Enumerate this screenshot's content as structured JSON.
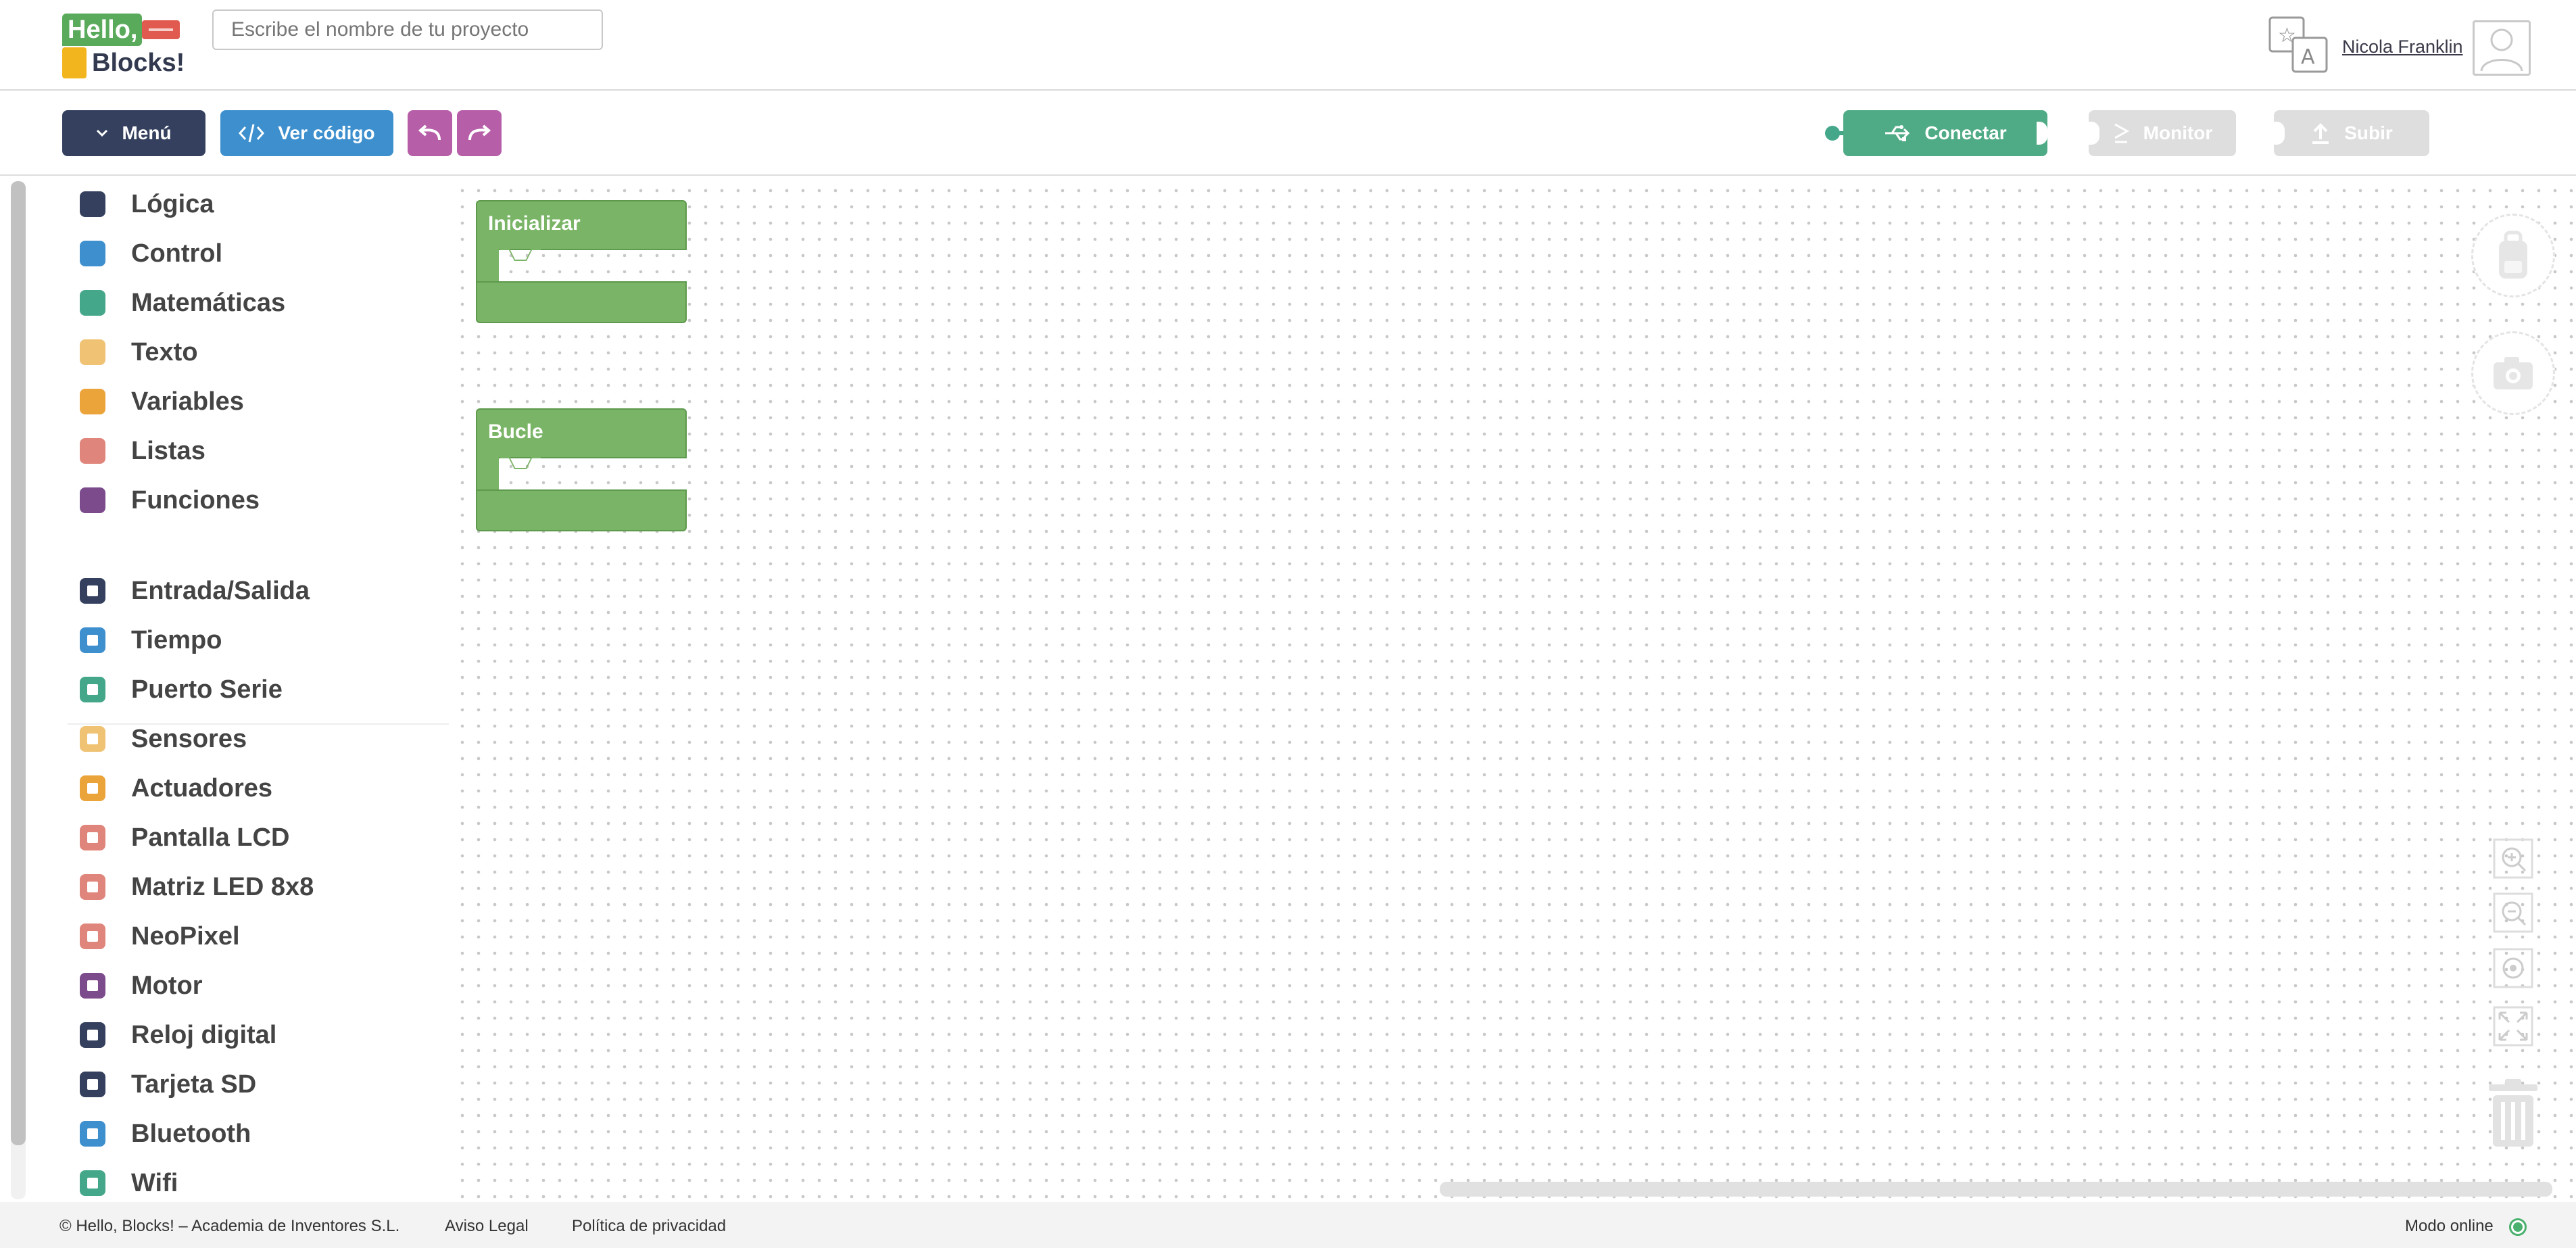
{
  "app": {
    "logo_line1": "Hello,",
    "logo_line2": "Blocks!"
  },
  "header": {
    "project_placeholder": "Escribe el nombre de tu proyecto",
    "user_name": "Nicola Franklin"
  },
  "toolbar": {
    "menu_label": "Menú",
    "code_label": "Ver código",
    "connect_label": "Conectar",
    "monitor_label": "Monitor",
    "upload_label": "Subir"
  },
  "sidebar": {
    "categories": [
      {
        "label": "Lógica",
        "color": "#34405e"
      },
      {
        "label": "Control",
        "color": "#3d8fce"
      },
      {
        "label": "Matemáticas",
        "color": "#45a78a"
      },
      {
        "label": "Texto",
        "color": "#f0c274"
      },
      {
        "label": "Variables",
        "color": "#eba43a"
      },
      {
        "label": "Listas",
        "color": "#e0857b"
      },
      {
        "label": "Funciones",
        "color": "#7c4b8c"
      }
    ],
    "hardware": [
      {
        "label": "Entrada/Salida",
        "color": "#34405e"
      },
      {
        "label": "Tiempo",
        "color": "#3d8fce"
      },
      {
        "label": "Puerto Serie",
        "color": "#45a78a"
      },
      {
        "label": "Sensores",
        "color": "#f0c274"
      },
      {
        "label": "Actuadores",
        "color": "#eba43a"
      },
      {
        "label": "Pantalla LCD",
        "color": "#e0857b"
      },
      {
        "label": "Matriz LED 8x8",
        "color": "#e0857b"
      },
      {
        "label": "NeoPixel",
        "color": "#e0857b"
      },
      {
        "label": "Motor",
        "color": "#7c4b8c"
      },
      {
        "label": "Reloj digital",
        "color": "#34405e"
      },
      {
        "label": "Tarjeta SD",
        "color": "#34405e"
      },
      {
        "label": "Bluetooth",
        "color": "#3d8fce"
      },
      {
        "label": "Wifi",
        "color": "#45a78a"
      }
    ]
  },
  "workspace": {
    "blocks": [
      {
        "label": "Inicializar"
      },
      {
        "label": "Bucle"
      }
    ]
  },
  "footer": {
    "copyright": "© Hello, Blocks! – Academia de Inventores S.L.",
    "legal": "Aviso Legal",
    "privacy": "Política de privacidad",
    "status": "Modo online"
  }
}
